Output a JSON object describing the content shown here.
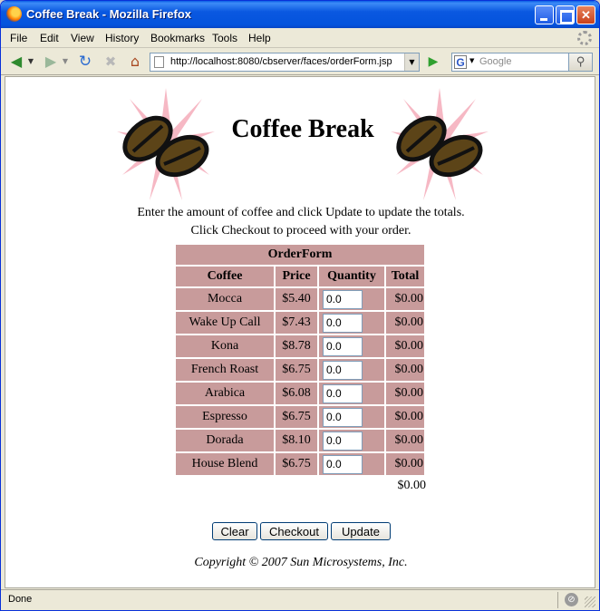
{
  "window": {
    "title": "Coffee Break - Mozilla Firefox"
  },
  "menubar": {
    "items": [
      "File",
      "Edit",
      "View",
      "History",
      "Bookmarks",
      "Tools",
      "Help"
    ]
  },
  "navbar": {
    "url": "http://localhost:8080/cbserver/faces/orderForm.jsp",
    "search_placeholder": "Google",
    "search_engine_glyph": "G"
  },
  "page": {
    "title": "Coffee Break",
    "intro_line1": "Enter the amount of coffee and click Update to update the totals.",
    "intro_line2": "Click Checkout to proceed with your order.",
    "table": {
      "caption": "OrderForm",
      "headers": [
        "Coffee",
        "Price",
        "Quantity",
        "Total"
      ],
      "rows": [
        {
          "coffee": "Mocca",
          "price": "$5.40",
          "quantity": "0.0",
          "total": "$0.00"
        },
        {
          "coffee": "Wake Up Call",
          "price": "$7.43",
          "quantity": "0.0",
          "total": "$0.00"
        },
        {
          "coffee": "Kona",
          "price": "$8.78",
          "quantity": "0.0",
          "total": "$0.00"
        },
        {
          "coffee": "French Roast",
          "price": "$6.75",
          "quantity": "0.0",
          "total": "$0.00"
        },
        {
          "coffee": "Arabica",
          "price": "$6.08",
          "quantity": "0.0",
          "total": "$0.00"
        },
        {
          "coffee": "Espresso",
          "price": "$6.75",
          "quantity": "0.0",
          "total": "$0.00"
        },
        {
          "coffee": "Dorada",
          "price": "$8.10",
          "quantity": "0.0",
          "total": "$0.00"
        },
        {
          "coffee": "House Blend",
          "price": "$6.75",
          "quantity": "0.0",
          "total": "$0.00"
        }
      ],
      "grand_total": "$0.00"
    },
    "buttons": {
      "clear": "Clear",
      "checkout": "Checkout",
      "update": "Update"
    },
    "copyright": "Copyright © 2007 Sun Microsystems, Inc."
  },
  "statusbar": {
    "text": "Done"
  },
  "colors": {
    "table_cell": "#c89b9b",
    "titlebar": "#0a58e0"
  }
}
